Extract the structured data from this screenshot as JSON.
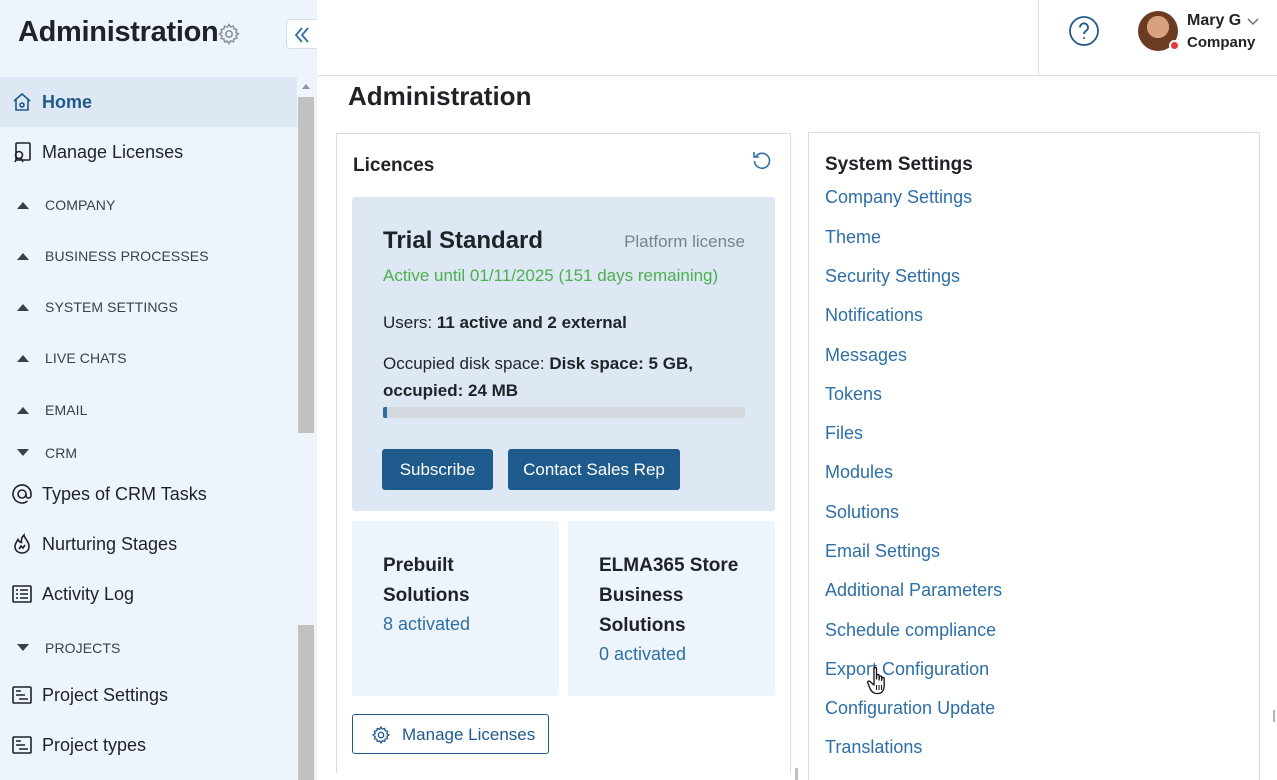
{
  "sidebar": {
    "title": "Administration",
    "items": [
      {
        "label": "Home",
        "icon": "home-icon",
        "active": true
      },
      {
        "label": "Manage Licenses",
        "icon": "license-icon"
      }
    ],
    "groups": {
      "company": "COMPANY",
      "business_processes": "BUSINESS PROCESSES",
      "system_settings": "SYSTEM SETTINGS",
      "live_chats": "LIVE CHATS",
      "email": "EMAIL",
      "crm": "CRM",
      "projects": "PROJECTS"
    },
    "crm_items": [
      {
        "label": "Types of CRM Tasks",
        "icon": "at-icon"
      },
      {
        "label": "Nurturing Stages",
        "icon": "flame-icon"
      },
      {
        "label": "Activity Log",
        "icon": "list-icon"
      }
    ],
    "project_items": [
      {
        "label": "Project Settings",
        "icon": "project-board-icon"
      },
      {
        "label": "Project types",
        "icon": "project-board-icon"
      }
    ]
  },
  "header": {
    "user_name": "Mary G",
    "user_company": "Company",
    "status_color": "#e53935"
  },
  "page": {
    "title": "Administration"
  },
  "licences": {
    "title": "Licences",
    "plan": "Trial Standard",
    "plan_type": "Platform license",
    "active_until": "Active until 01/11/2025 (151 days remaining)",
    "users_label": "Users:",
    "users_value": "11 active and 2 external",
    "disk_label": "Occupied disk space:",
    "disk_value": "Disk space: 5 GB, occupied: 24 MB",
    "disk_usage_fraction": 0.0047,
    "subscribe_label": "Subscribe",
    "contact_label": "Contact Sales Rep",
    "prebuilt": {
      "title": "Prebuilt Solutions",
      "link": "8 activated"
    },
    "store": {
      "title": "ELMA365 Store Business Solutions",
      "link": "0 activated"
    },
    "manage_label": "Manage Licenses"
  },
  "system_settings": {
    "title": "System Settings",
    "links": [
      "Company Settings",
      "Theme",
      "Security Settings",
      "Notifications",
      "Messages",
      "Tokens",
      "Files",
      "Modules",
      "Solutions",
      "Email Settings",
      "Additional Parameters",
      "Schedule compliance",
      "Export Configuration",
      "Configuration Update",
      "Translations"
    ]
  },
  "colors": {
    "accent": "#1f5a8c",
    "link": "#2d6fa6",
    "success": "#4caf50",
    "sidebar_bg": "#eef4fb"
  }
}
